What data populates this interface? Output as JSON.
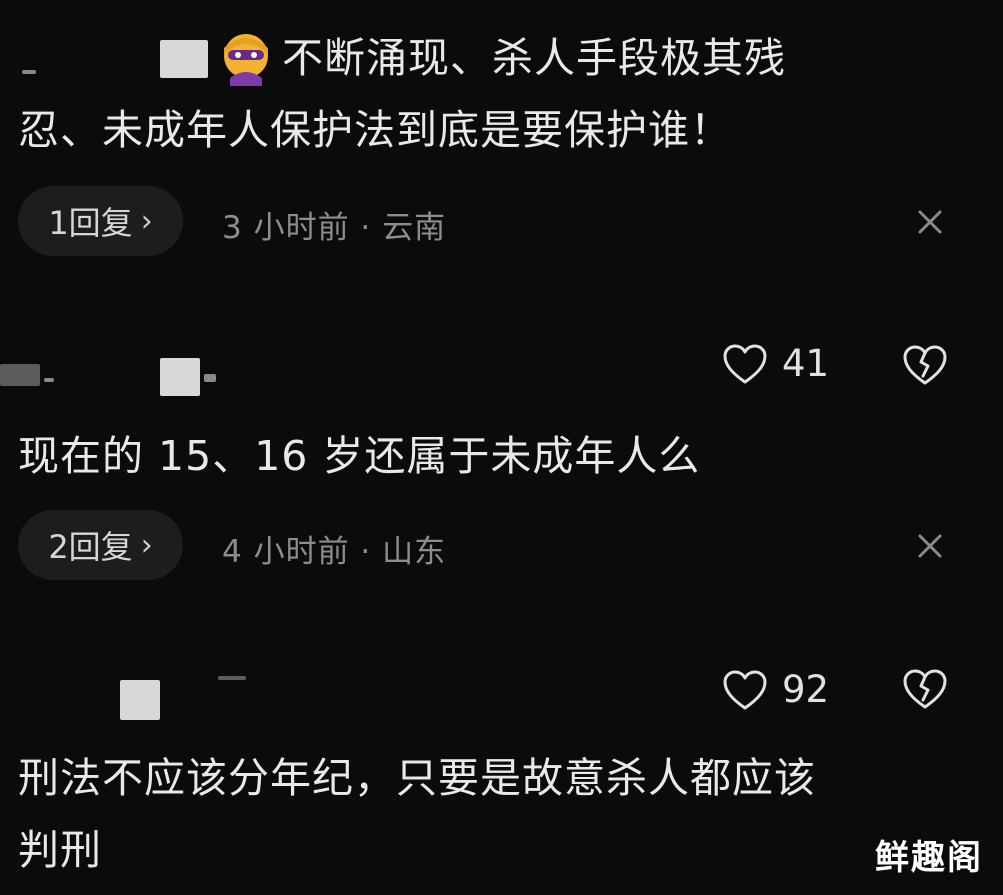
{
  "comments": [
    {
      "text_line1": "不断涌现、杀人手段极其残",
      "text_line2": "忍、未成年人保护法到底是要保护谁！",
      "reply_label": "1回复",
      "chevron": "›",
      "meta": "3 小时前 · 云南"
    },
    {
      "likes": "41",
      "text_line1": "现在的 15、16 岁还属于未成年人么",
      "reply_label": "2回复",
      "chevron": "›",
      "meta": "4 小时前 · 山东"
    },
    {
      "likes": "92",
      "text_line1": "刑法不应该分年纪，只要是故意杀人都应该",
      "text_line2": "判刑"
    }
  ],
  "icons": {
    "like": "heart-outline-icon",
    "dislike": "broken-heart-icon",
    "close": "close-icon",
    "emoji": "supervillain-emoji-icon"
  },
  "colors": {
    "background": "#0b0b0b",
    "text": "#e9e9e9",
    "meta": "#8d8d8d",
    "pill": "#1d1d1d"
  },
  "watermark": "鲜趣阁"
}
